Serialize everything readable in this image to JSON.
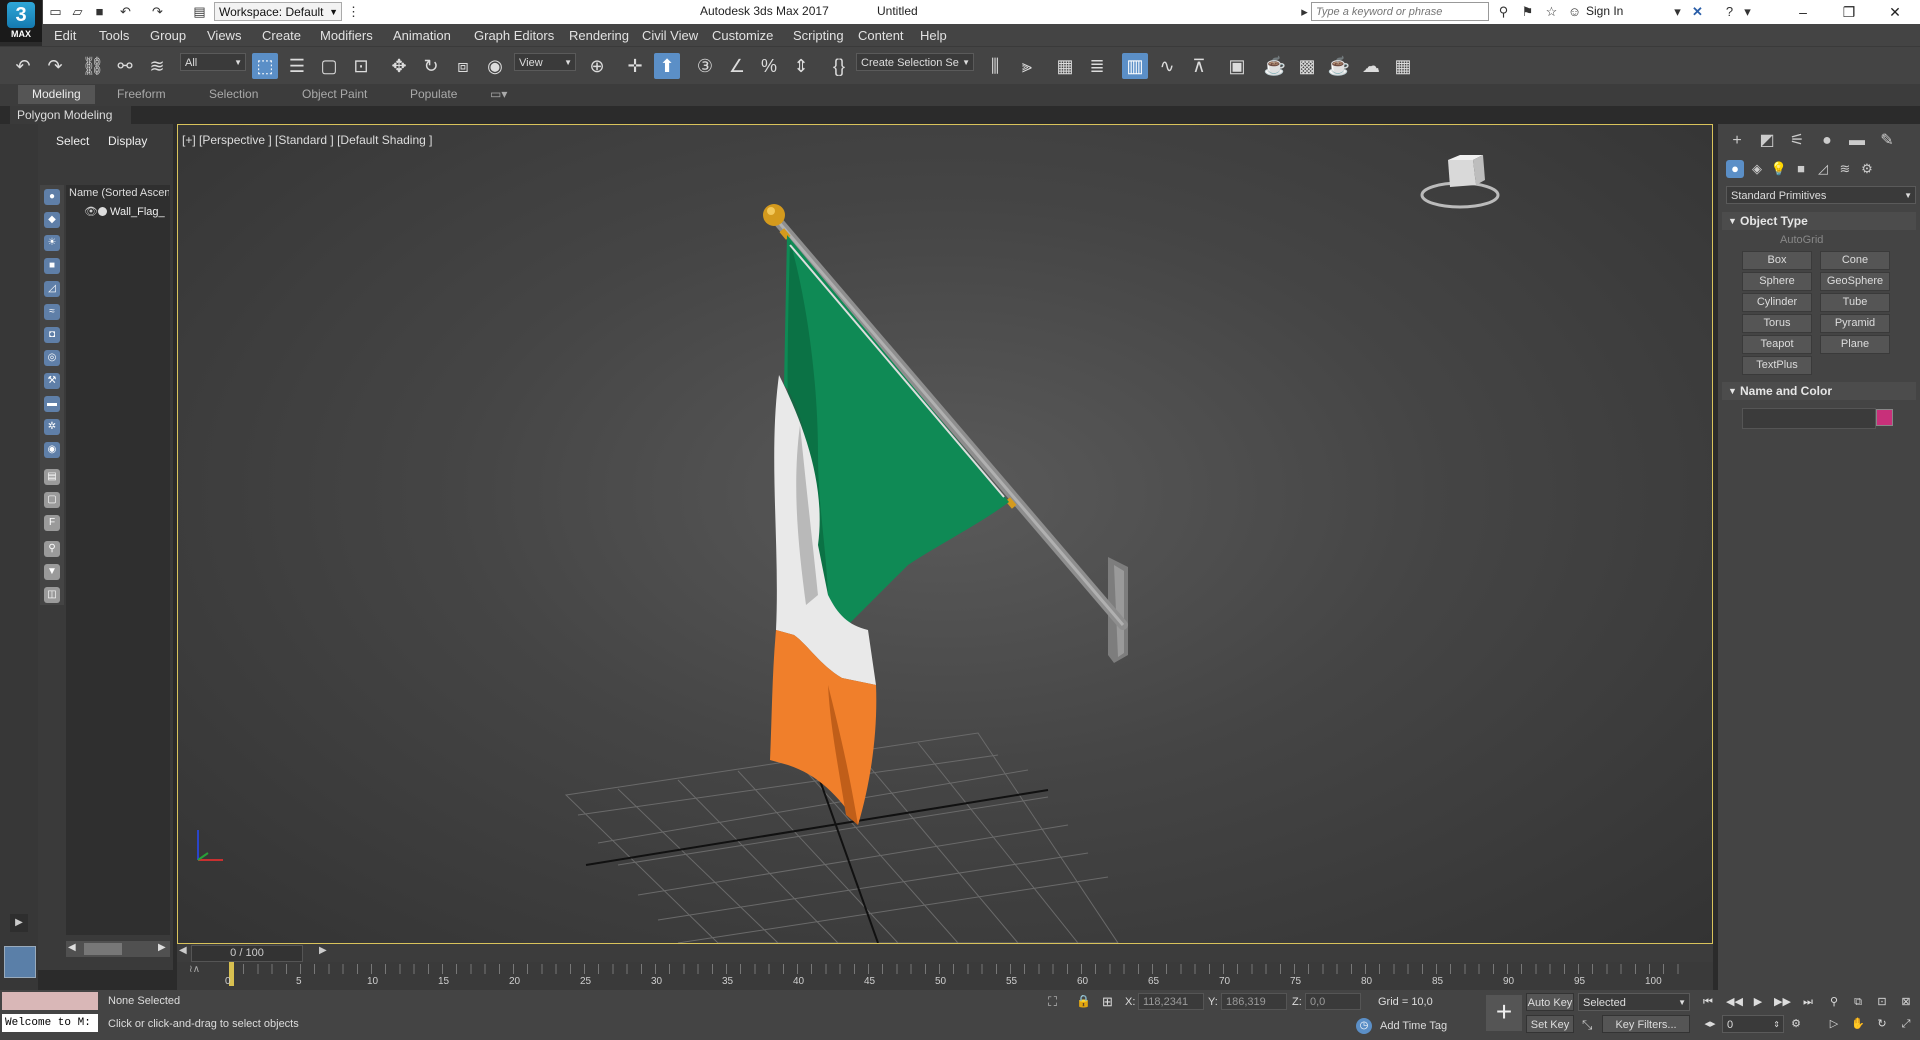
{
  "titlebar": {
    "workspace": "Workspace: Default",
    "app_title": "Autodesk 3ds Max 2017",
    "doc_title": "Untitled",
    "search_placeholder": "Type a keyword or phrase",
    "signin": "Sign In"
  },
  "logo": {
    "mark": "3",
    "text": "MAX"
  },
  "menu": [
    "Edit",
    "Tools",
    "Group",
    "Views",
    "Create",
    "Modifiers",
    "Animation",
    "Graph Editors",
    "Rendering",
    "Civil View",
    "Customize",
    "Scripting",
    "Content",
    "Help"
  ],
  "toolbar": {
    "filter": "All",
    "refcoord": "View",
    "selection_set": "Create Selection Se"
  },
  "ribbon": {
    "tabs": [
      "Modeling",
      "Freeform",
      "Selection",
      "Object Paint",
      "Populate"
    ],
    "active_panel": "Polygon Modeling"
  },
  "explorer": {
    "tabs": [
      "Select",
      "Display"
    ],
    "column": "Name (Sorted Ascen",
    "items": [
      "Wall_Flag_"
    ]
  },
  "viewport": {
    "label": "[+] [Perspective ] [Standard ] [Default Shading ]",
    "flag_colors": {
      "green": "#0f8a55",
      "white": "#e9e9e9",
      "orange": "#f07f2b"
    }
  },
  "command_panel": {
    "category": "Standard Primitives",
    "object_type": "Object Type",
    "autogrid": "AutoGrid",
    "primitives": [
      "Box",
      "Cone",
      "Sphere",
      "GeoSphere",
      "Cylinder",
      "Tube",
      "Torus",
      "Pyramid",
      "Teapot",
      "Plane",
      "TextPlus"
    ],
    "name_and_color": "Name and Color",
    "object_color": "#c8307a"
  },
  "timeslider": {
    "counter": "0 / 100",
    "ticks": [
      "0",
      "5",
      "10",
      "15",
      "20",
      "25",
      "30",
      "35",
      "40",
      "45",
      "50",
      "55",
      "60",
      "65",
      "70",
      "75",
      "80",
      "85",
      "90",
      "95",
      "100"
    ]
  },
  "status": {
    "script_text": "Welcome to M:",
    "selection": "None Selected",
    "prompt": "Click or click-and-drag to select objects",
    "x_label": "X:",
    "x": "118,2341",
    "y_label": "Y:",
    "y": "186,319",
    "z_label": "Z:",
    "z": "0,0",
    "grid": "Grid = 10,0",
    "add_time_tag": "Add Time Tag",
    "auto_key": "Auto Key",
    "set_key": "Set Key",
    "selected": "Selected",
    "key_filters": "Key Filters...",
    "current_frame": "0"
  }
}
